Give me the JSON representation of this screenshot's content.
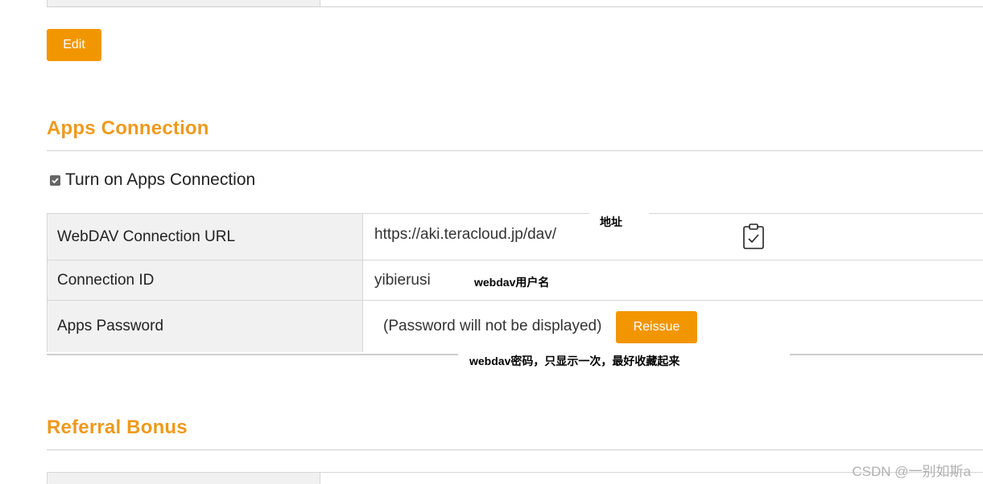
{
  "buttons": {
    "edit": "Edit",
    "reissue": "Reissue"
  },
  "apps_connection": {
    "title": "Apps Connection",
    "toggle_label": "Turn on Apps Connection",
    "toggle_checked": true,
    "rows": [
      {
        "label": "WebDAV Connection URL",
        "value": "https://aki.teracloud.jp/dav/"
      },
      {
        "label": "Connection ID",
        "value": "yibierusi"
      },
      {
        "label": "Apps Password",
        "value": "(Password will not be displayed)"
      }
    ]
  },
  "annotations": {
    "address": "地址",
    "username": "webdav用户名",
    "password": "webdav密码，只显示一次，最好收藏起来"
  },
  "referral": {
    "title": "Referral Bonus"
  },
  "watermark": "CSDN @一别如斯a",
  "icons": {
    "copy": "clipboard-check-icon",
    "checkbox": "checkmark-icon"
  },
  "colors": {
    "accent": "#f29600",
    "title": "#ee9a1d"
  }
}
